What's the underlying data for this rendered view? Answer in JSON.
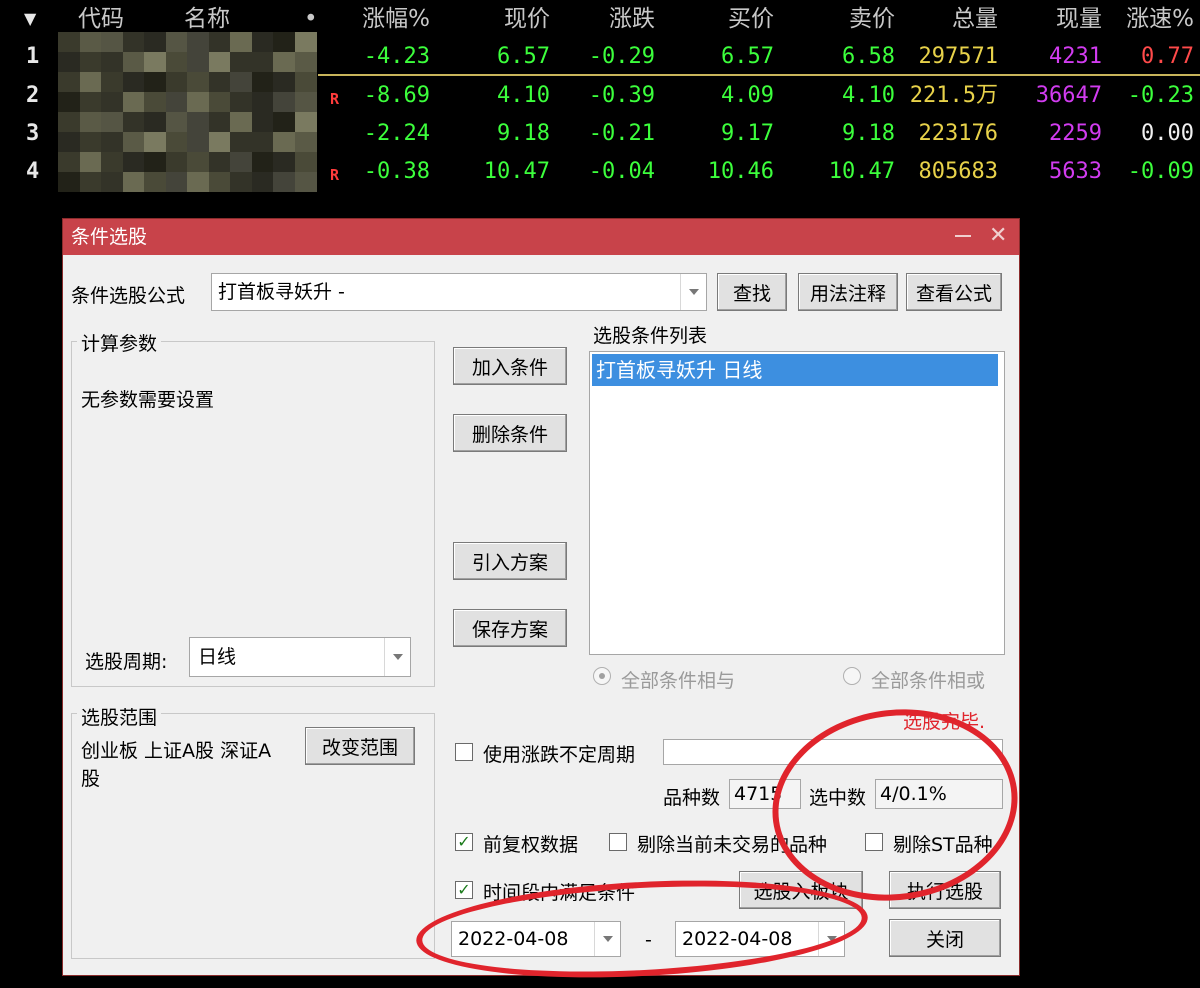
{
  "table": {
    "headers": {
      "sort_icon": "caret-down-icon",
      "code": "代码",
      "name": "名称",
      "dot": "•",
      "chg_pct": "涨幅%",
      "price": "现价",
      "change": "涨跌",
      "bid": "买价",
      "ask": "卖价",
      "volume": "总量",
      "cur_vol": "现量",
      "speed": "涨速%"
    },
    "rows": [
      {
        "idx": "1",
        "flag": "",
        "chg_pct": "-4.23",
        "price": "6.57",
        "change": "-0.29",
        "bid": "6.57",
        "ask": "6.58",
        "volume": "297571",
        "cur_vol": "4231",
        "speed": "0.77",
        "speed_color": "red"
      },
      {
        "idx": "2",
        "flag": "R",
        "chg_pct": "-8.69",
        "price": "4.10",
        "change": "-0.39",
        "bid": "4.09",
        "ask": "4.10",
        "volume": "221.5万",
        "cur_vol": "36647",
        "speed": "-0.23",
        "speed_color": "green"
      },
      {
        "idx": "3",
        "flag": "",
        "chg_pct": "-2.24",
        "price": "9.18",
        "change": "-0.21",
        "bid": "9.17",
        "ask": "9.18",
        "volume": "223176",
        "cur_vol": "2259",
        "speed": "0.00",
        "speed_color": "white"
      },
      {
        "idx": "4",
        "flag": "R",
        "chg_pct": "-0.38",
        "price": "10.47",
        "change": "-0.04",
        "bid": "10.46",
        "ask": "10.47",
        "volume": "805683",
        "cur_vol": "5633",
        "speed": "-0.09",
        "speed_color": "green"
      }
    ]
  },
  "dialog": {
    "title": "条件选股",
    "close_glyph": "✕",
    "formula_label": "条件选股公式",
    "formula_value": "打首板寻妖升 -",
    "find_button": "查找",
    "usage_button": "用法注释",
    "view_formula_button": "查看公式",
    "params_group_title": "计算参数",
    "params_message": "无参数需要设置",
    "period_label": "选股周期:",
    "period_value": "日线",
    "scope_group_title": "选股范围",
    "scope_text": "创业板 上证A股 深证A股",
    "change_scope_button": "改变范围",
    "add_condition_button": "加入条件",
    "delete_condition_button": "删除条件",
    "import_plan_button": "引入方案",
    "save_plan_button": "保存方案",
    "condition_list_title": "选股条件列表",
    "condition_item": "打首板寻妖升  日线",
    "all_and_label": "全部条件相与",
    "all_or_label": "全部条件相或",
    "status_text": "选股完毕.",
    "use_period_label": "使用涨跌不定周期",
    "variety_count_label": "品种数",
    "variety_count_value": "4715",
    "selected_count_label": "选中数",
    "selected_count_value": "4/0.1%",
    "adjusted_label": "前复权数据",
    "exclude_untraded_label": "剔除当前未交易的品种",
    "exclude_st_label": "剔除ST品种",
    "time_range_label": "时间段内满足条件",
    "add_to_block_button": "选股入板块",
    "run_button": "执行选股",
    "close_button": "关闭",
    "date_from": "2022-04-08",
    "date_sep": "-",
    "date_to": "2022-04-08",
    "check_glyph": "✓"
  },
  "colors": {
    "titlebar": "#c8434a",
    "selection": "#3d8fe0",
    "annotation": "#e0242c",
    "up": "#ff4a4a",
    "down": "#3cff3c",
    "volume": "#e8d24a",
    "cur_volume": "#d23cf0"
  }
}
